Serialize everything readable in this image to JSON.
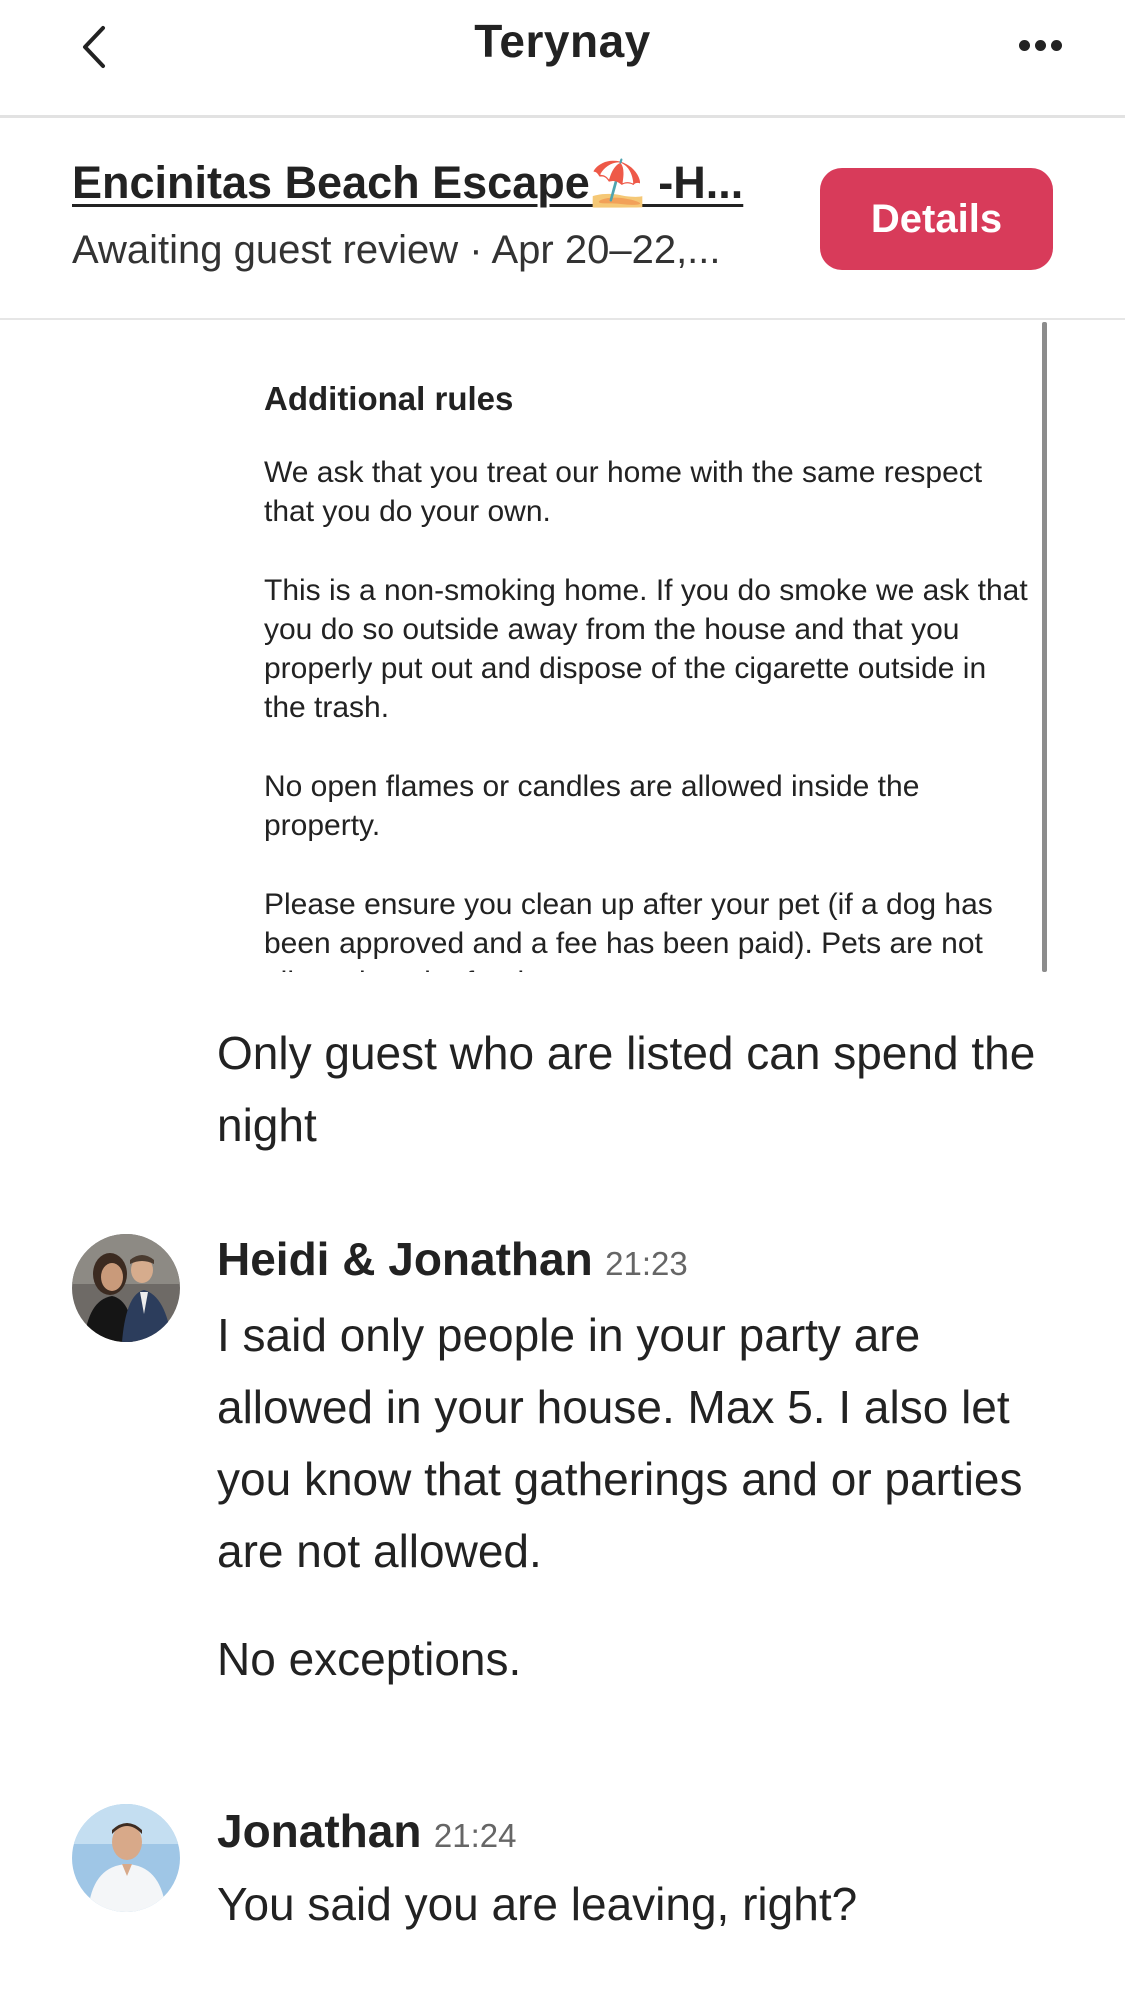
{
  "nav": {
    "title": "Terynay",
    "back_icon": "chevron-left-icon",
    "more_icon": "more-horizontal-icon"
  },
  "listing": {
    "title": "Encinitas Beach Escape⛱️ -H...",
    "status": "Awaiting guest review · Apr 20–22,...",
    "details_label": "Details"
  },
  "rules_card": {
    "heading": "Additional rules",
    "paragraphs": [
      "We ask that you treat our home with the same respect that you do your own.",
      "This is a non-smoking home. If you do smoke we ask that you do so outside away from the house and that you properly put out and dispose of the cigarette outside in the trash.",
      "No open flames or candles are allowed inside the property.",
      "Please ensure you clean up after your pet (if a dog has been approved and a fee has been paid). Pets are not allowed on the furniture."
    ]
  },
  "messages": [
    {
      "sender": "",
      "time": "",
      "paragraphs": [
        "Only guest who are listed can spend the night"
      ]
    },
    {
      "sender": "Heidi & Jonathan",
      "time": "21:23",
      "paragraphs": [
        "I said only people in your party are allowed in your house. Max 5. I also let you know that gatherings and or parties are not allowed.",
        "No exceptions."
      ]
    },
    {
      "sender": "Jonathan",
      "time": "21:24",
      "paragraphs": [
        "You said you are leaving, right?"
      ]
    }
  ],
  "colors": {
    "accent": "#d83b5a",
    "text": "#222222",
    "muted": "#666666",
    "divider": "#e2e2e2"
  }
}
